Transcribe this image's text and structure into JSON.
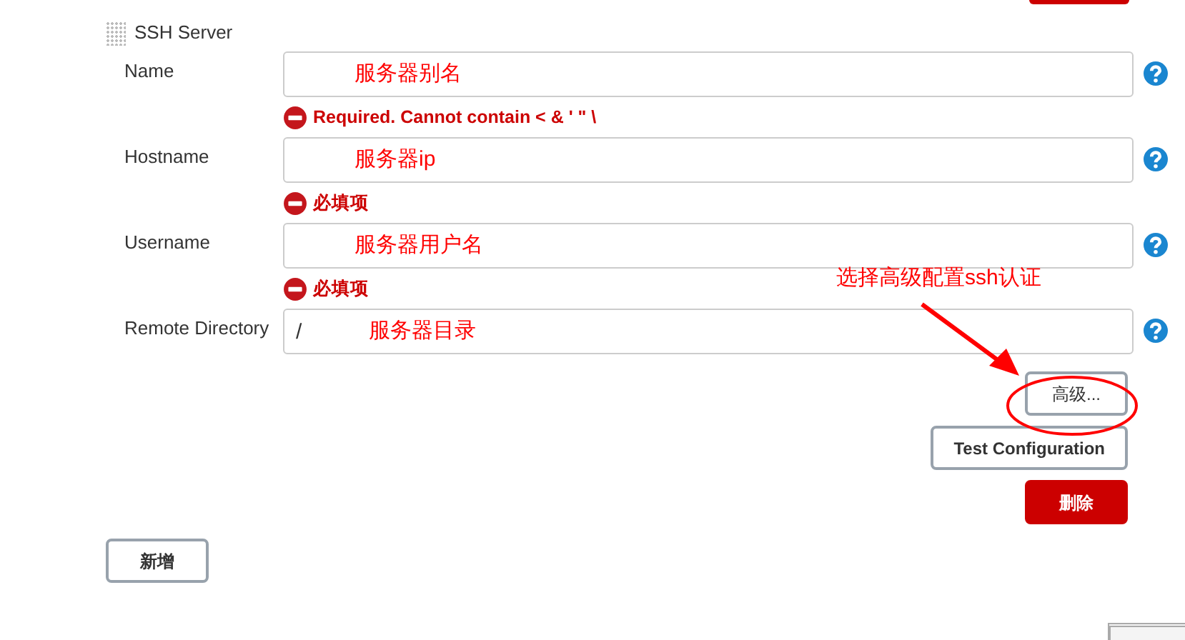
{
  "section": {
    "title": "SSH Server"
  },
  "fields": [
    {
      "label": "Name",
      "annotation": "服务器别名",
      "error": "Required. Cannot contain < & ' \" \\"
    },
    {
      "label": "Hostname",
      "annotation": "服务器ip",
      "error": "必填项"
    },
    {
      "label": "Username",
      "annotation": "服务器用户名",
      "error": "必填项"
    },
    {
      "label": "Remote Directory",
      "value": "/",
      "annotation": "服务器目录"
    }
  ],
  "callout": {
    "text": "选择高级配置ssh认证"
  },
  "buttons": [
    {
      "kind": "plain",
      "label": "高级..."
    },
    {
      "kind": "plain",
      "label": "Test Configuration"
    },
    {
      "kind": "danger",
      "label": "删除"
    }
  ],
  "add_button": {
    "label": "新增"
  }
}
